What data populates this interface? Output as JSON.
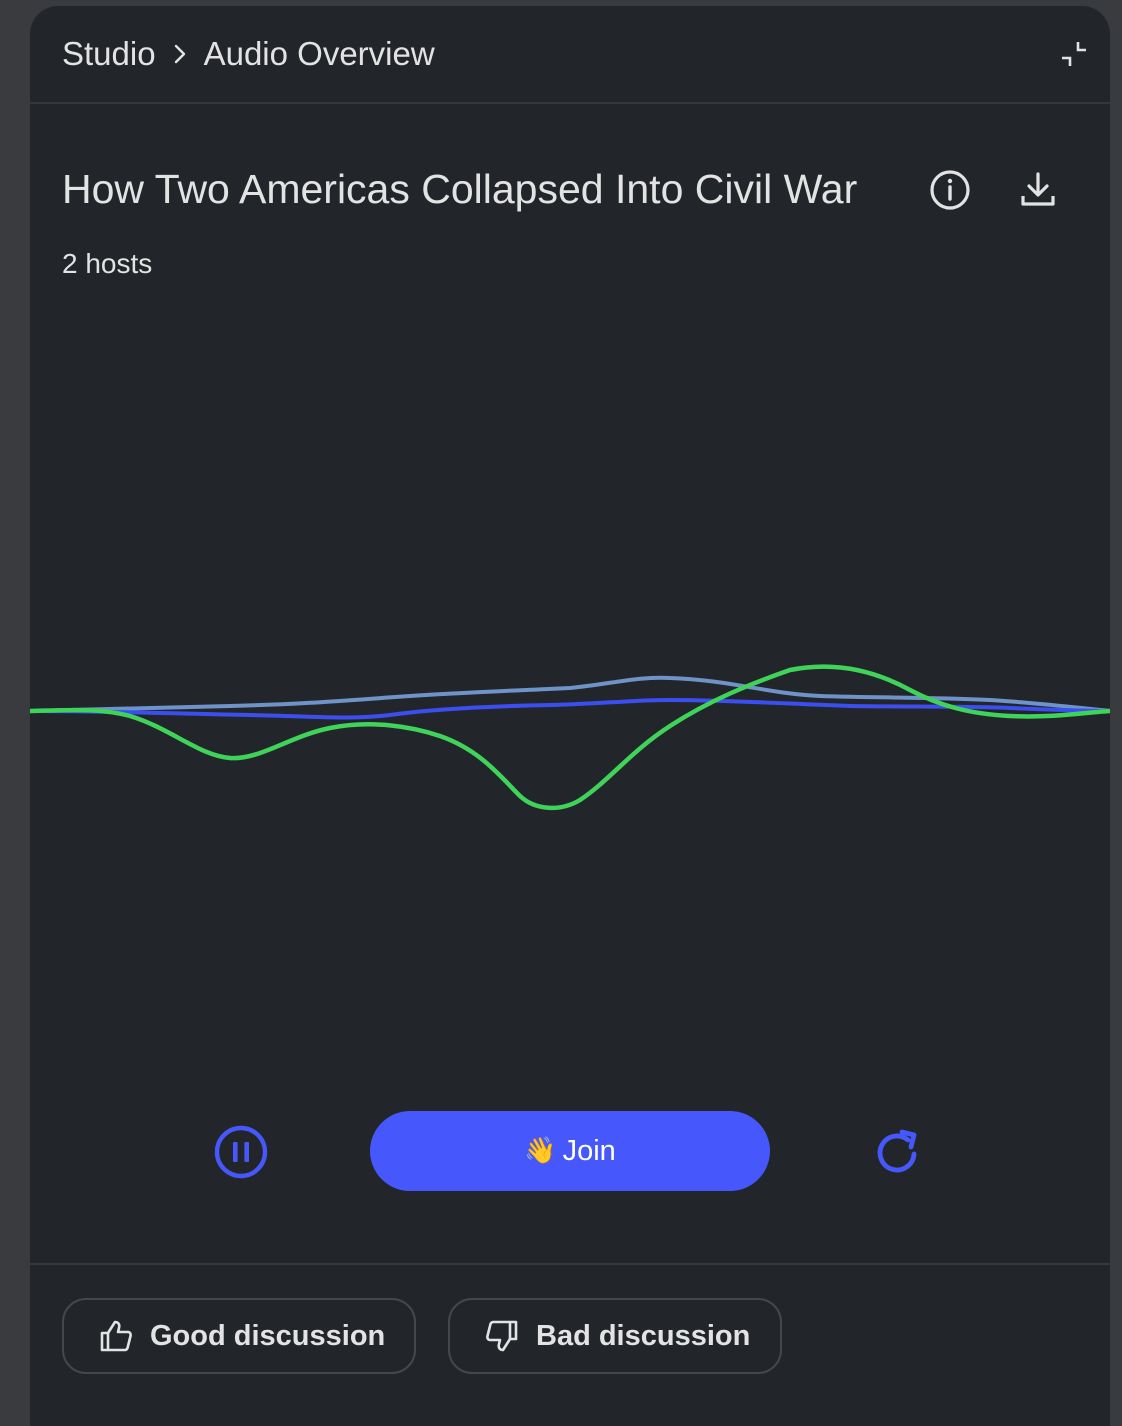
{
  "header": {
    "breadcrumb": [
      "Studio",
      "Audio Overview"
    ],
    "collapse_icon": "collapse-icon"
  },
  "overview": {
    "title": "How Two Americas Collapsed Into Civil War",
    "hosts": "2 hosts",
    "info_icon": "info-icon",
    "download_icon": "download-icon"
  },
  "waveform": {
    "colors": {
      "green": "#3fd35a",
      "blue": "#3b4ef0",
      "steel": "#6e93c9"
    }
  },
  "controls": {
    "pause_icon": "pause-icon",
    "join_emoji": "👋",
    "join_label": "Join",
    "replay_icon": "replay-icon",
    "accent": "#4658fb"
  },
  "feedback": {
    "good_label": "Good discussion",
    "bad_label": "Bad discussion",
    "good_icon": "thumbs-up-icon",
    "bad_icon": "thumbs-down-icon"
  }
}
